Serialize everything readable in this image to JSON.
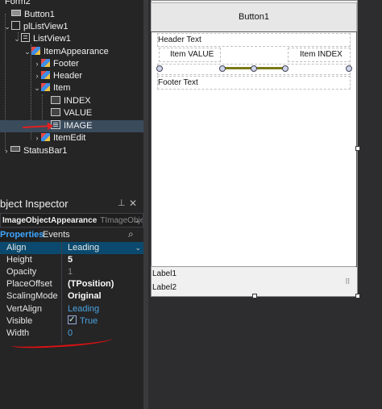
{
  "structure_tree": {
    "nodes": [
      {
        "label": "Form2"
      },
      {
        "label": "Button1"
      },
      {
        "label": "plListView1"
      },
      {
        "label": "ListView1"
      },
      {
        "label": "ItemAppearance"
      },
      {
        "label": "Footer"
      },
      {
        "label": "Header"
      },
      {
        "label": "Item"
      },
      {
        "label": "INDEX"
      },
      {
        "label": "VALUE"
      },
      {
        "label": "IMAGE"
      },
      {
        "label": "ItemEdit"
      },
      {
        "label": "StatusBar1"
      }
    ]
  },
  "object_inspector": {
    "title": "bject Inspector",
    "pin_icon": "pin-icon",
    "close_icon": "close-icon",
    "selected_object": "ImageObjectAppearance",
    "selected_type": "TImageObje",
    "tabs": {
      "properties": "Properties",
      "events": "Events"
    },
    "properties": [
      {
        "name": "Align",
        "value": "Leading"
      },
      {
        "name": "Height",
        "value": "5"
      },
      {
        "name": "Opacity",
        "value": "1"
      },
      {
        "name": "PlaceOffset",
        "value": "(TPosition)"
      },
      {
        "name": "ScalingMode",
        "value": "Original"
      },
      {
        "name": "VertAlign",
        "value": "Leading"
      },
      {
        "name": "Visible",
        "value": "True"
      },
      {
        "name": "Width",
        "value": "0"
      }
    ]
  },
  "designer": {
    "button_caption": "Button1",
    "header_text": "Header Text",
    "item_value": "Item VALUE",
    "item_index": "Item INDEX",
    "footer_text": "Footer Text",
    "label1": "Label1",
    "label2": "Label2",
    "grip_glyph": "⠿"
  },
  "colors": {
    "selection_blue": "#0b4a6e",
    "link_blue": "#4aa3df",
    "annotation_red": "#e02020"
  }
}
